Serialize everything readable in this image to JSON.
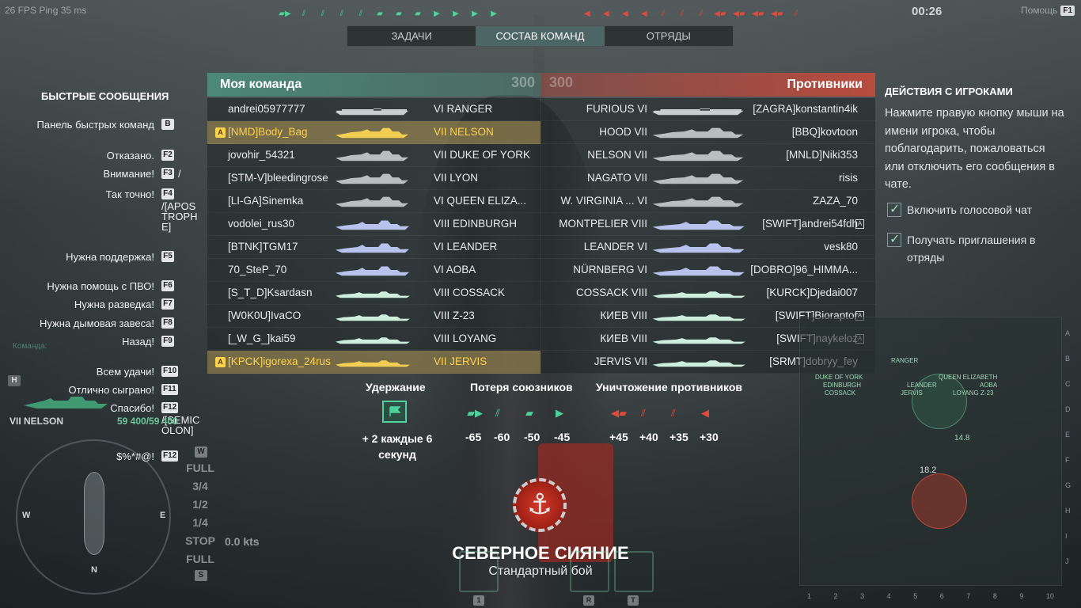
{
  "hud": {
    "fps": "26 FPS   Ping  35 ms",
    "timer": "00:26",
    "help_label": "Помощь",
    "help_key": "F1"
  },
  "tabs": [
    {
      "label": "ЗАДАЧИ",
      "active": false
    },
    {
      "label": "СОСТАВ КОМАНД",
      "active": true
    },
    {
      "label": "ОТРЯДЫ",
      "active": false
    }
  ],
  "quick_messages": {
    "title": "БЫСТРЫЕ СООБЩЕНИЯ",
    "items": [
      {
        "label": "Панель быстрых команд",
        "key": "B"
      },
      {
        "label": "Отказано.",
        "key": "F2"
      },
      {
        "label": "Внимание!",
        "key": "F3",
        "extra": "/"
      },
      {
        "label": "Так точно!",
        "key": "F4",
        "extra": "/[APOSTROPHE]"
      },
      {
        "label": "Нужна поддержка!",
        "key": "F5"
      },
      {
        "label": "Нужна помощь с ПВО!",
        "key": "F6"
      },
      {
        "label": "Нужна разведка!",
        "key": "F7"
      },
      {
        "label": "Нужна дымовая завеса!",
        "key": "F8"
      },
      {
        "label": "Назад!",
        "key": "F9"
      },
      {
        "label": "Всем удачи!",
        "key": "F10"
      },
      {
        "label": "Отлично сыграно!",
        "key": "F11"
      },
      {
        "label": "Спасибо!",
        "key": "F12",
        "extra": "/[SEMICOLON]"
      },
      {
        "label": "$%*#@!",
        "key": "F12"
      }
    ]
  },
  "my_team": {
    "title": "Моя команда",
    "score": "300",
    "rows": [
      {
        "player": "andrei05977777",
        "ship": "VI  RANGER",
        "division": "",
        "highlight": false,
        "class": "cv"
      },
      {
        "player": "[NMD]Body_Bag",
        "ship": "VII  NELSON",
        "division": "A",
        "highlight": true,
        "class": "bb"
      },
      {
        "player": "jovohir_54321",
        "ship": "VII  DUKE OF YORK",
        "division": "",
        "highlight": false,
        "class": "bb"
      },
      {
        "player": "[STM-V]bleedingrose",
        "ship": "VII  LYON",
        "division": "",
        "highlight": false,
        "class": "bb"
      },
      {
        "player": "[LI-GA]Sinemka",
        "ship": "VI  QUEEN ELIZA...",
        "division": "",
        "highlight": false,
        "class": "bb"
      },
      {
        "player": "vodolei_rus30",
        "ship": "VIII  EDINBURGH",
        "division": "",
        "highlight": false,
        "class": "ca"
      },
      {
        "player": "[BTNK]TGM17",
        "ship": "VI  LEANDER",
        "division": "",
        "highlight": false,
        "class": "ca"
      },
      {
        "player": "70_SteP_70",
        "ship": "VI  AOBA",
        "division": "",
        "highlight": false,
        "class": "ca"
      },
      {
        "player": "[S_T_D]Ksardasn",
        "ship": "VIII  COSSACK",
        "division": "",
        "highlight": false,
        "class": "dd"
      },
      {
        "player": "[W0K0U]IvaCO",
        "ship": "VIII  Z-23",
        "division": "",
        "highlight": false,
        "class": "dd"
      },
      {
        "player": "[_W_G_]kai59",
        "ship": "VIII  LOYANG",
        "division": "",
        "highlight": false,
        "class": "dd"
      },
      {
        "player": "[KPCK]igorexa_24rus",
        "ship": "VII  JERVIS",
        "division": "A",
        "highlight": true,
        "class": "dd"
      }
    ]
  },
  "enemy_team": {
    "title": "Противники",
    "score": "300",
    "rows": [
      {
        "ship": "FURIOUS  VI",
        "player": "[ZAGRA]konstantin4ik",
        "division": "",
        "class": "cv"
      },
      {
        "ship": "HOOD  VII",
        "player": "[BBQ]kovtoon",
        "division": "",
        "class": "bb"
      },
      {
        "ship": "NELSON  VII",
        "player": "[MNLD]Niki353",
        "division": "",
        "class": "bb"
      },
      {
        "ship": "NAGATO  VII",
        "player": "risis",
        "division": "",
        "class": "bb"
      },
      {
        "ship": "W. VIRGINIA ...  VI",
        "player": "ZAZA_70",
        "division": "",
        "class": "bb"
      },
      {
        "ship": "MONTPELIER  VIII",
        "player": "[SWIFT]andrei54fdh",
        "division": "A",
        "class": "ca"
      },
      {
        "ship": "LEANDER  VI",
        "player": "vesk80",
        "division": "",
        "class": "ca"
      },
      {
        "ship": "NÜRNBERG  VI",
        "player": "[DOBRO]96_HIMMA...",
        "division": "",
        "class": "ca"
      },
      {
        "ship": "COSSACK  VIII",
        "player": "[KURCK]Djedai007",
        "division": "",
        "class": "dd"
      },
      {
        "ship": "КИЕВ  VIII",
        "player": "[SWIFT]Bioraptor",
        "division": "A",
        "class": "dd"
      },
      {
        "ship": "КИЕВ  VIII",
        "player": "[SWIFT]naykeloz",
        "division": "A",
        "class": "dd"
      },
      {
        "ship": "JERVIS  VII",
        "player": "[SRMT]dobryy_fey",
        "division": "",
        "class": "dd"
      }
    ]
  },
  "player_actions": {
    "title": "ДЕЙСТВИЯ С ИГРОКАМИ",
    "text": "Нажмите правую кнопку мыши на имени игрока, чтобы поблагодарить, пожаловаться или отключить его сообщения в чате.",
    "voice_chat": "Включить голосовой чат",
    "invites": "Получать приглашения в отряды"
  },
  "scoring": {
    "capture_title": "Удержание",
    "capture_value": "+ 2 каждые 6 секунд",
    "ally_loss_title": "Потеря союзников",
    "ally_loss_values": [
      "-65",
      "-60",
      "-50",
      "-45"
    ],
    "enemy_kill_title": "Уничтожение противников",
    "enemy_kill_values": [
      "+45",
      "+40",
      "+35",
      "+30"
    ]
  },
  "map": {
    "name": "СЕВЕРНОЕ СИЯНИЕ",
    "mode": "Стандартный бой"
  },
  "self": {
    "ship": "VII NELSON",
    "hp": "59 400/59 400",
    "throttle": [
      "FULL",
      "3/4",
      "1/2",
      "1/4",
      "STOP",
      "FULL"
    ],
    "speed": "0.0 kts",
    "w_key": "W",
    "s_key": "S",
    "h_key": "H",
    "compass_n": "N",
    "compass_w": "W",
    "compass_e": "E",
    "team_caption": "Команда:"
  },
  "minimap": {
    "cols": [
      "1",
      "2",
      "3",
      "4",
      "5",
      "6",
      "7",
      "8",
      "9",
      "10"
    ],
    "rows": [
      "A",
      "B",
      "C",
      "D",
      "E",
      "F",
      "G",
      "H",
      "I",
      "J"
    ],
    "labels": [
      "RANGER",
      "DUKE OF YORK",
      "EDINBURGH",
      "COSSACK",
      "LEANDER",
      "JERVIS",
      "QUEEN ELIZABETH",
      "AOBA",
      "LOYANG Z-23",
      "14.8",
      "18.2"
    ]
  },
  "consumable_keys": [
    "1",
    "R",
    "T"
  ],
  "colors": {
    "my_team": "#4c8c78",
    "enemy_team": "#be4c3e",
    "highlight": "#ffd24d",
    "ally_icon": "#4fd19a",
    "enemy_icon": "#e2493a"
  }
}
